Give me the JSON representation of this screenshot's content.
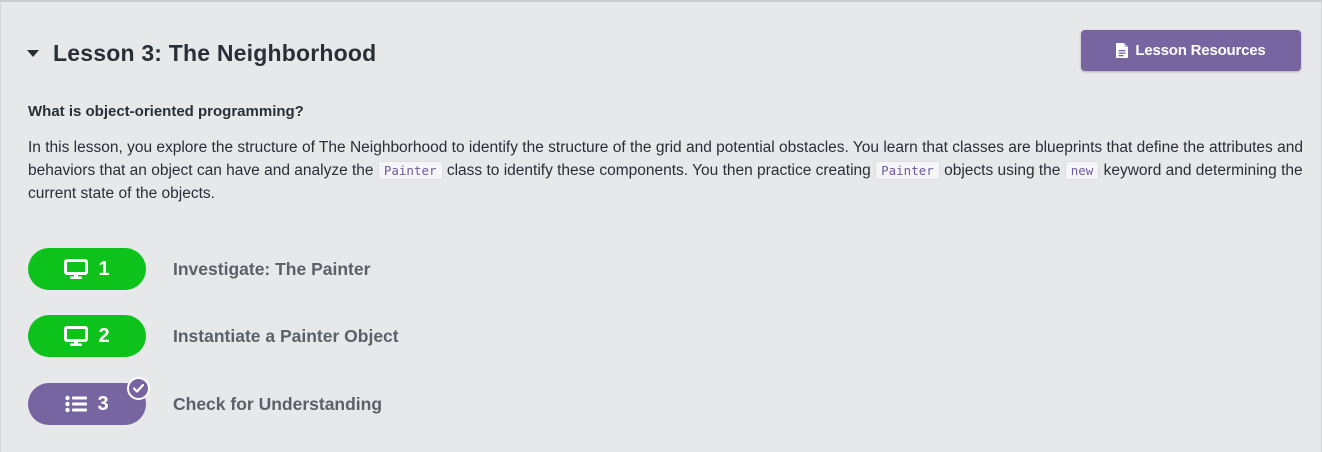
{
  "lesson": {
    "title": "Lesson 3: The Neighborhood",
    "resources_label": "Lesson Resources",
    "question": "What is object-oriented programming?",
    "description": {
      "p1": "In this lesson, you explore the structure of The Neighborhood to identify the structure of the grid and potential obstacles. You learn that classes are blueprints that define the attributes and behaviors that an object can have and analyze the ",
      "code1": "Painter",
      "p2": " class to identify these components. You then practice creating ",
      "code2": "Painter",
      "p3": " objects using the ",
      "code3": "new",
      "p4": " keyword and determining the current state of the objects."
    }
  },
  "activities": [
    {
      "number": "1",
      "title": "Investigate: The Painter",
      "icon": "monitor-icon",
      "color": "#0dc21b"
    },
    {
      "number": "2",
      "title": "Instantiate a Painter Object",
      "icon": "monitor-icon",
      "color": "#0dc21b"
    },
    {
      "number": "3",
      "title": "Check for Understanding",
      "icon": "list-icon",
      "color": "#7665a0",
      "completed_icon": "checkmark-badge-icon"
    }
  ],
  "colors": {
    "accent_purple": "#7665a0",
    "accent_green": "#0dc21b",
    "background": "#e7e8ea"
  }
}
